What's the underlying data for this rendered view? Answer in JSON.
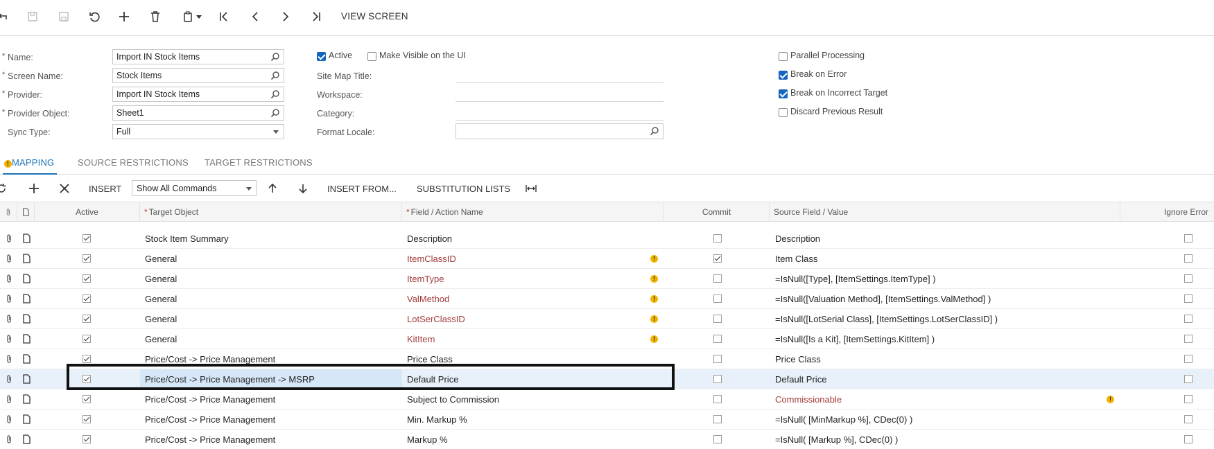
{
  "toolbar": {
    "view_screen_label": "VIEW SCREEN"
  },
  "form": {
    "name_label": "Name:",
    "name_value": "Import IN Stock Items",
    "screen_name_label": "Screen Name:",
    "screen_name_value": "Stock Items",
    "provider_label": "Provider:",
    "provider_value": "Import IN Stock Items",
    "provider_object_label": "Provider Object:",
    "provider_object_value": "Sheet1",
    "sync_type_label": "Sync Type:",
    "sync_type_value": "Full",
    "active_label": "Active",
    "make_visible_label": "Make Visible on the UI",
    "site_map_title_label": "Site Map Title:",
    "workspace_label": "Workspace:",
    "category_label": "Category:",
    "format_locale_label": "Format Locale:",
    "parallel_label": "Parallel Processing",
    "break_error_label": "Break on Error",
    "break_target_label": "Break on Incorrect Target",
    "discard_label": "Discard Previous Result"
  },
  "tabs": {
    "mapping": "MAPPING",
    "source_restrictions": "SOURCE RESTRICTIONS",
    "target_restrictions": "TARGET RESTRICTIONS"
  },
  "grid_toolbar": {
    "insert": "INSERT",
    "commands_select": "Show All Commands",
    "insert_from": "INSERT FROM...",
    "substitution_lists": "SUBSTITUTION LISTS"
  },
  "grid": {
    "headers": {
      "active": "Active",
      "target_object": "Target Object",
      "field_action": "Field / Action Name",
      "commit": "Commit",
      "source_field": "Source Field / Value",
      "ignore_error": "Ignore Error"
    },
    "rows": [
      {
        "target": "Stock Item Summary",
        "field": "Description",
        "source": "Description",
        "commit": false,
        "field_error": false,
        "source_error": false
      },
      {
        "target": "General",
        "field": "ItemClassID",
        "source": "Item Class",
        "commit": true,
        "field_error": true,
        "source_error": false
      },
      {
        "target": "General",
        "field": "ItemType",
        "source": "=IsNull([Type], [ItemSettings.ItemType] )",
        "commit": false,
        "field_error": true,
        "source_error": false
      },
      {
        "target": "General",
        "field": "ValMethod",
        "source": "=IsNull([Valuation Method], [ItemSettings.ValMethod] )",
        "commit": false,
        "field_error": true,
        "source_error": false
      },
      {
        "target": "General",
        "field": "LotSerClassID",
        "source": "=IsNull([LotSerial Class], [ItemSettings.LotSerClassID] )",
        "commit": false,
        "field_error": true,
        "source_error": false
      },
      {
        "target": "General",
        "field": "KitItem",
        "source": "=IsNull([Is a Kit], [ItemSettings.KitItem] )",
        "commit": false,
        "field_error": true,
        "source_error": false
      },
      {
        "target": "Price/Cost -> Price Management",
        "field": "Price Class",
        "source": "Price Class",
        "commit": false,
        "field_error": false,
        "source_error": false
      },
      {
        "target": "Price/Cost -> Price Management -> MSRP",
        "field": "Default Price",
        "source": "Default Price",
        "commit": false,
        "field_error": false,
        "source_error": false,
        "selected": true
      },
      {
        "target": "Price/Cost -> Price Management",
        "field": "Subject to Commission",
        "source": "Commissionable",
        "commit": false,
        "field_error": false,
        "source_error": true
      },
      {
        "target": "Price/Cost -> Price Management",
        "field": "Min. Markup %",
        "source": "=IsNull( [MinMarkup %], CDec(0) )",
        "commit": false,
        "field_error": false,
        "source_error": false
      },
      {
        "target": "Price/Cost -> Price Management",
        "field": "Markup %",
        "source": "=IsNull( [Markup %], CDec(0) )",
        "commit": false,
        "field_error": false,
        "source_error": false
      }
    ]
  },
  "colors": {
    "accent": "#1a73b8",
    "error_text": "#a33b3b",
    "warning": "#f0b400",
    "selected_row": "#e8f1fa"
  }
}
